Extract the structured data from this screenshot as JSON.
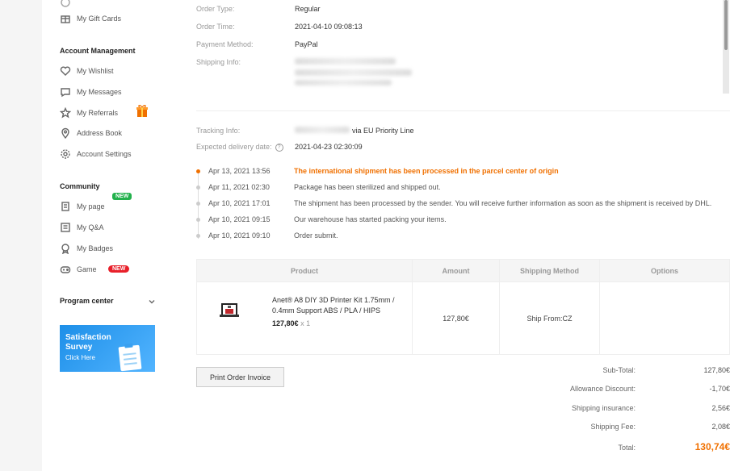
{
  "sidebar": {
    "gift_cards": "My Gift Cards",
    "account_head": "Account Management",
    "wishlist": "My Wishlist",
    "messages": "My Messages",
    "referrals": "My Referrals",
    "address_book": "Address Book",
    "account_settings": "Account Settings",
    "community_head": "Community",
    "my_page": "My page",
    "new_badge": "NEW",
    "my_qa": "My Q&A",
    "my_badges": "My Badges",
    "game": "Game",
    "game_badge": "NEW",
    "program_center": "Program center",
    "banner_title": "Satisfaction Survey",
    "banner_cta": "Click Here"
  },
  "order": {
    "order_type_label": "Order Type:",
    "order_type": "Regular",
    "order_time_label": "Order Time:",
    "order_time": "2021-04-10 09:08:13",
    "payment_label": "Payment Method:",
    "payment": "PayPal",
    "shipping_info_label": "Shipping Info:",
    "tracking_label": "Tracking Info:",
    "tracking_suffix": "via EU Priority Line",
    "expected_label": "Expected delivery date:",
    "expected": "2021-04-23 02:30:09",
    "help_glyph": "?"
  },
  "timeline": [
    {
      "date": "Apr 13, 2021 13:56",
      "text": "The international shipment has been processed in the parcel center of origin",
      "active": true
    },
    {
      "date": "Apr 11, 2021 02:30",
      "text": "Package has been sterilized and shipped out.",
      "active": false
    },
    {
      "date": "Apr 10, 2021 17:01",
      "text": "The shipment has been processed by the sender. You will receive further information as soon as the shipment is received by DHL.",
      "active": false
    },
    {
      "date": "Apr 10, 2021 09:15",
      "text": "Our warehouse has started packing your items.",
      "active": false
    },
    {
      "date": "Apr 10, 2021 09:10",
      "text": "Order submit.",
      "active": false
    }
  ],
  "table": {
    "headers": {
      "product": "Product",
      "amount": "Amount",
      "shipping": "Shipping Method",
      "options": "Options"
    },
    "product_name": "Anet® A8 DIY 3D Printer Kit 1.75mm / 0.4mm Support ABS / PLA / HIPS",
    "product_price": "127,80€",
    "product_qty": "x 1",
    "amount": "127,80€",
    "ship_from": "Ship From:CZ"
  },
  "print_button": "Print Order Invoice",
  "summary": {
    "subtotal_label": "Sub-Total:",
    "subtotal": "127,80€",
    "allowance_label": "Allowance Discount:",
    "allowance": "-1,70€",
    "insurance_label": "Shipping insurance:",
    "insurance": "2,56€",
    "fee_label": "Shipping Fee:",
    "fee": "2,08€",
    "total_label": "Total:",
    "total": "130,74€"
  },
  "colors": {
    "accent": "#f07000",
    "new_badge": "#22b14c",
    "game_badge": "#e8202a",
    "banner": "#1d8fe8"
  }
}
